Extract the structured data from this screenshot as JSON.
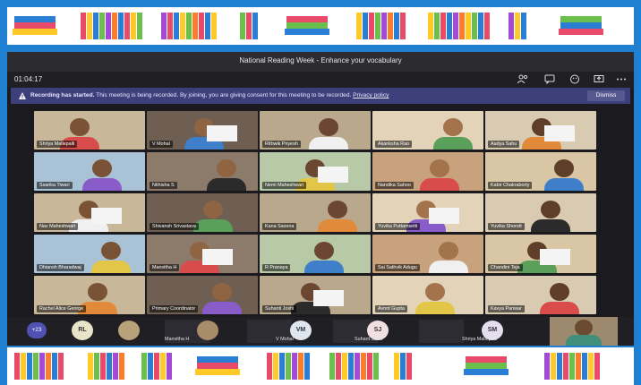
{
  "meeting": {
    "title": "National Reading Week - Enhance your vocabulary",
    "timer": "01:04:17"
  },
  "toolbar_icons": [
    "participants-icon",
    "chat-icon",
    "reactions-icon",
    "share-icon",
    "more-icon"
  ],
  "banner": {
    "heading": "Recording has started.",
    "message": "This meeting is being recorded. By joining, you are giving consent for this meeting to be recorded.",
    "link": "Privacy policy",
    "dismiss": "Dismiss"
  },
  "tiles": [
    "Shriya Mallepalli",
    "V Mohal",
    "Rithwik Priyesh",
    "Akanksha Rao",
    "Aadya Sahu",
    "Ssarika Tiwari",
    "Nithisha S",
    "Nemi Maheshwari",
    "Nandika Sahoo",
    "Kabir Chakraborty",
    "Nav Maheshwari",
    "Shivansh Srivastava",
    "Kana Saxena",
    "Yuvika Puttamsetti",
    "Yuvika Shorott",
    "Dhiansh Bharadwaj",
    "Manvitha H",
    "R Pranaya",
    "Sai Sathvik Adugu",
    "Chandini Teja",
    "Rachel Alice George",
    "Primary Coordinator",
    "Suhanti Joshi",
    "Avnnt Gupta",
    "Kavya Panwar"
  ],
  "bottom": {
    "overflow_count": "+23",
    "avatars": [
      "RL",
      "VM",
      "SJ",
      "SM"
    ],
    "names": [
      "Manvitha H",
      "V Mohal",
      "Suhant Joshi",
      "Shriya Mallepalli"
    ]
  },
  "colors": {
    "frame": "#1f7fd0",
    "teams_bg": "#1b1b1f",
    "banner": "#3d3f7a",
    "accent": "#4f52b2"
  }
}
